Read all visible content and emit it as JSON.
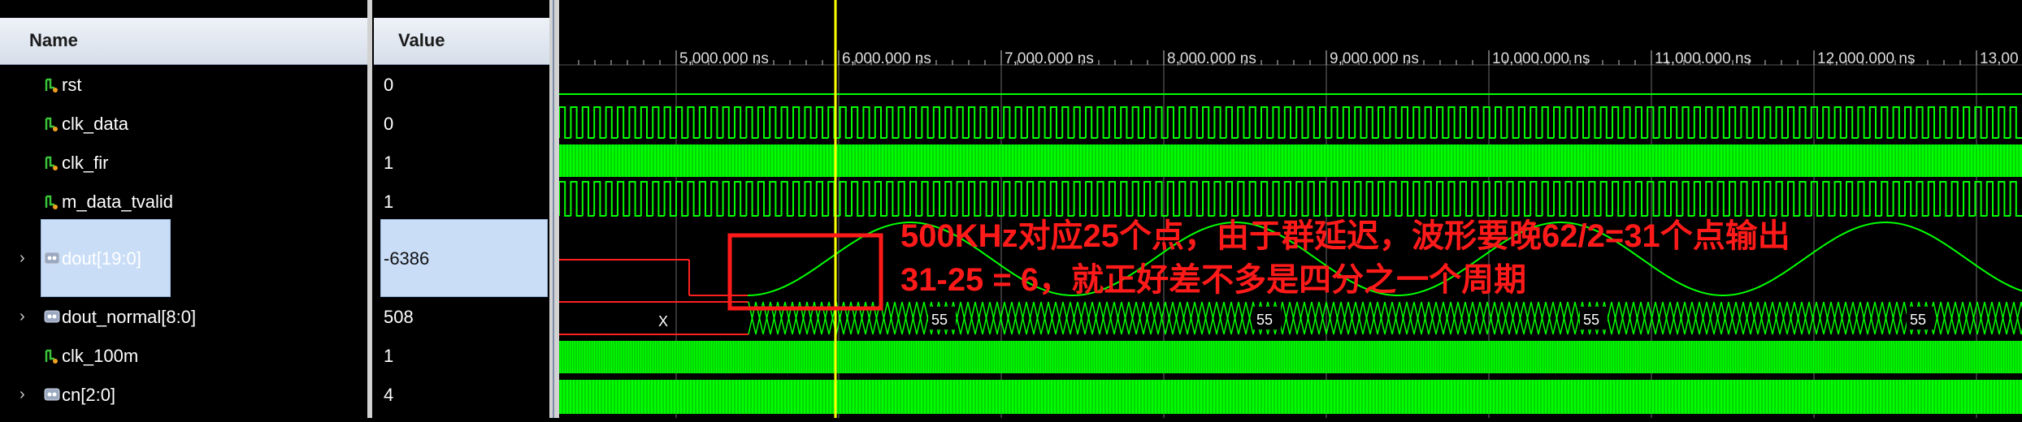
{
  "columns": {
    "name": "Name",
    "value": "Value"
  },
  "signals": [
    {
      "name": "rst",
      "value": "0",
      "expandable": false
    },
    {
      "name": "clk_data",
      "value": "0",
      "expandable": false
    },
    {
      "name": "clk_fir",
      "value": "1",
      "expandable": false
    },
    {
      "name": "m_data_tvalid",
      "value": "1",
      "expandable": false
    },
    {
      "name": "dout[19:0]",
      "value": "-6386",
      "expandable": true,
      "selected": true
    },
    {
      "name": "dout_normal[8:0]",
      "value": "508",
      "expandable": true
    },
    {
      "name": "clk_100m",
      "value": "1",
      "expandable": false
    },
    {
      "name": "cn[2:0]",
      "value": "4",
      "expandable": true
    }
  ],
  "timeline": {
    "unit": "ns",
    "labels": [
      "5,000.000 ns",
      "6,000.000 ns",
      "7,000.000 ns",
      "8,000.000 ns",
      "9,000.000 ns",
      "10,000.000 ns",
      "11,000.000 ns",
      "12,000.000 ns",
      "13,00"
    ],
    "cursor_ns": 6000
  },
  "bus_values": {
    "dout_normal_unknown": "X",
    "dout_normal_repeat": "55"
  },
  "annotation": {
    "line1": "500KHz对应25个点，由于群延迟，波形要晚62/2=31个点输出",
    "line2": "31-25 = 6，就正好差不多是四分之一个周期"
  },
  "colors": {
    "wave": "#00ff00",
    "cursor": "#ffff00",
    "annotation": "#ff1a1a",
    "selection": "#c9ddf7"
  }
}
